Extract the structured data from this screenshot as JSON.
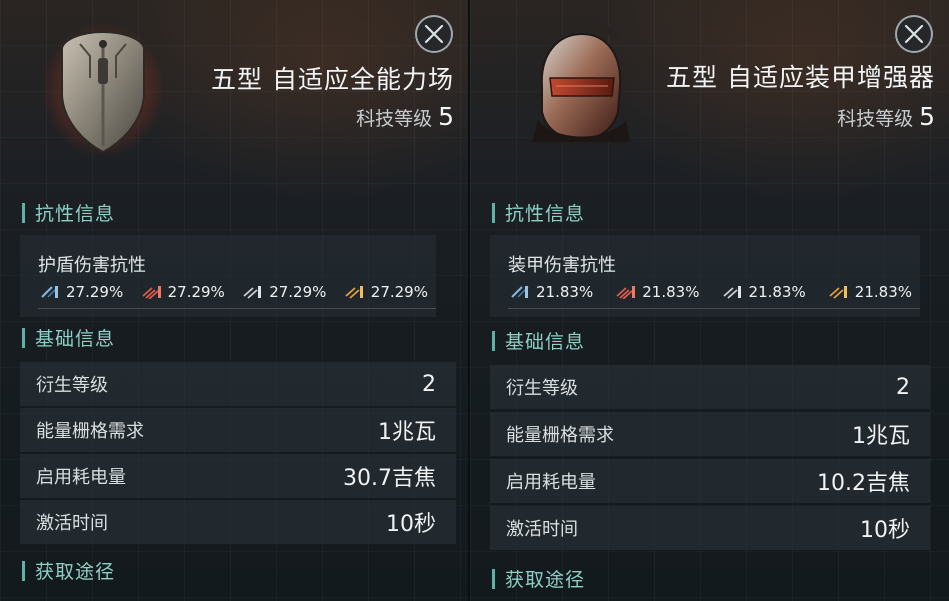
{
  "panels": [
    {
      "item_name": "五型 自适应全能力场",
      "tech_label": "科技等级",
      "tech_level": "5",
      "resistance_section": "抗性信息",
      "resistance_label": "护盾伤害抗性",
      "resistances": [
        "27.29%",
        "27.29%",
        "27.29%",
        "27.29%"
      ],
      "basic_section": "基础信息",
      "rows": [
        {
          "label": "衍生等级",
          "value": "2"
        },
        {
          "label": "能量栅格需求",
          "value": "1兆瓦"
        },
        {
          "label": "启用耗电量",
          "value": "30.7吉焦"
        },
        {
          "label": "激活时间",
          "value": "10秒"
        }
      ],
      "source_section": "获取途径"
    },
    {
      "item_name": "五型 自适应装甲增强器",
      "tech_label": "科技等级",
      "tech_level": "5",
      "resistance_section": "抗性信息",
      "resistance_label": "装甲伤害抗性",
      "resistances": [
        "21.83%",
        "21.83%",
        "21.83%",
        "21.83%"
      ],
      "basic_section": "基础信息",
      "rows": [
        {
          "label": "衍生等级",
          "value": "2"
        },
        {
          "label": "能量栅格需求",
          "value": "1兆瓦"
        },
        {
          "label": "启用耗电量",
          "value": "10.2吉焦"
        },
        {
          "label": "激活时间",
          "value": "10秒"
        }
      ],
      "source_section": "获取途径"
    }
  ],
  "damage_types": [
    "em-icon",
    "thermal-icon",
    "kinetic-icon",
    "explosive-icon"
  ],
  "colors": {
    "accent": "#5fb2a4",
    "section_text": "#8fd0c4",
    "em": "#7fb8e0",
    "thermal": "#e05a4a",
    "kinetic": "#c8ccd0",
    "explosive": "#e0a040"
  }
}
